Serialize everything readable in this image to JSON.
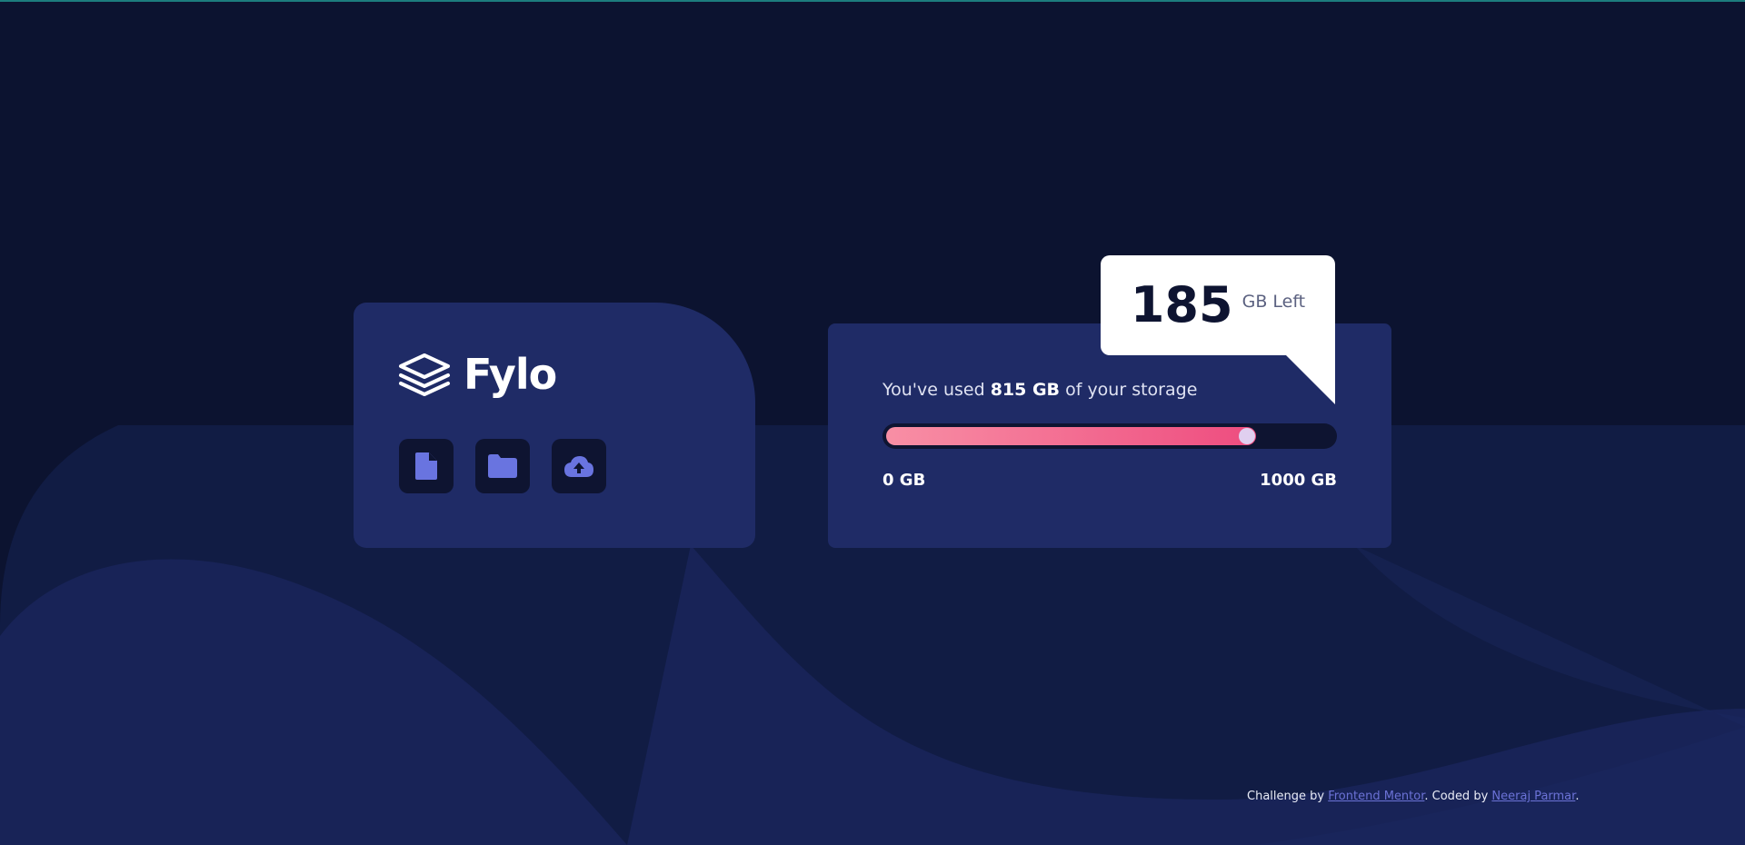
{
  "brand": {
    "name": "Fylo",
    "icon": "stacked-layers-logo"
  },
  "file_actions": [
    {
      "icon": "document-icon",
      "label": "File"
    },
    {
      "icon": "folder-icon",
      "label": "Folder"
    },
    {
      "icon": "cloud-upload-icon",
      "label": "Upload"
    }
  ],
  "storage": {
    "used_prefix": "You've used ",
    "used_value": "815 GB",
    "used_suffix": " of your storage",
    "used_gb": 815,
    "total_gb": 1000,
    "progress_fraction": 0.815,
    "min_label": "0 GB",
    "max_label": "1000 GB"
  },
  "callout": {
    "remaining": "185",
    "unit": "GB Left"
  },
  "attribution": {
    "prefix": "Challenge by ",
    "challenge_link": "Frontend Mentor",
    "middle": ". Coded by ",
    "author_link": "Neeraj Parmar",
    "suffix": "."
  },
  "colors": {
    "background": "#0c1330",
    "card": "#1f2b66",
    "dark_tile": "#0e1431",
    "icon_accent": "#6974e0",
    "progress_start": "#f88fa5",
    "progress_end": "#ee4c7f",
    "link": "#6b72d6"
  }
}
